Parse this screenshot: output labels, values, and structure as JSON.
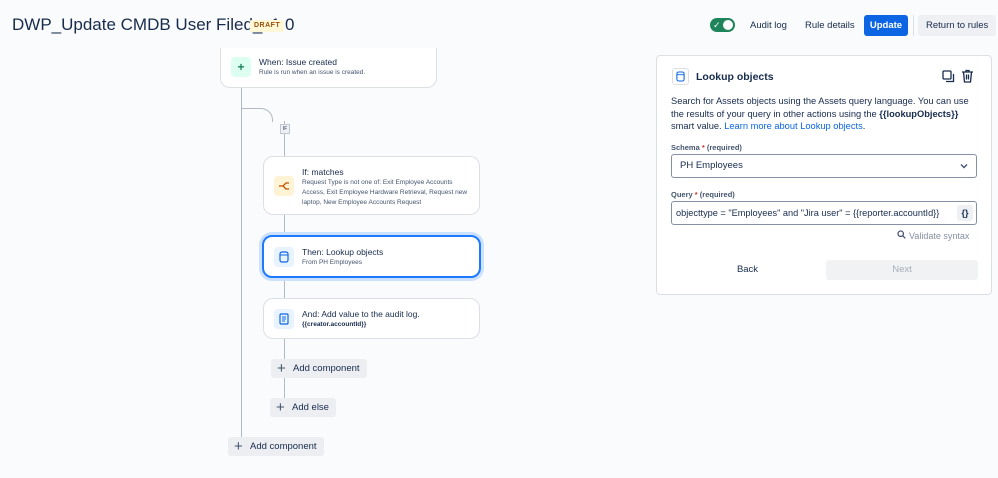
{
  "header": {
    "title": "DWP_Update CMDB User Filed_v1.0",
    "status": "DRAFT",
    "audit_log": "Audit log",
    "rule_details": "Rule details",
    "update": "Update",
    "return_to_rules": "Return to rules"
  },
  "flow": {
    "trigger": {
      "title": "When: Issue created",
      "subtitle": "Rule is run when an issue is created."
    },
    "if_badge": "IF",
    "condition": {
      "title": "If: matches",
      "subtitle": "Request Type is not one of: Exit Employee Accounts Access, Exit Employee Hardware Retrieval, Request new laptop, New Employee Accounts Request"
    },
    "action_lookup": {
      "title": "Then: Lookup objects",
      "subtitle": "From PH Employees"
    },
    "action_audit": {
      "title": "And: Add value to the audit log.",
      "subtitle": "{{creator.accountId}}"
    },
    "add_component_inner": "Add component",
    "add_else": "Add else",
    "add_component_outer": "Add component"
  },
  "panel": {
    "title": "Lookup objects",
    "desc_part1": "Search for Assets objects using the Assets query language. You can use the results of your query in other actions using the ",
    "desc_bold": "{{lookupObjects}}",
    "desc_part2": " smart value. ",
    "desc_link": "Learn more about Lookup objects",
    "desc_end": ".",
    "schema_label": "Schema",
    "required_star": "*",
    "required_text": "(required)",
    "schema_value": "PH Employees",
    "query_label": "Query",
    "query_value": "objecttype = \"Employees\" and \"Jira user\" = {{reporter.accountId}}",
    "query_button": "{}",
    "validate": "Validate syntax",
    "back": "Back",
    "next": "Next"
  },
  "colors": {
    "primary": "#0c66e4",
    "toggle_on": "#1f845a",
    "draft_bg": "#fff7d6",
    "selected_border": "#1d7afc"
  },
  "icons": {
    "trigger": "plus-icon",
    "condition": "branch-icon",
    "lookup": "database-icon",
    "audit": "document-icon",
    "duplicate": "duplicate-icon",
    "delete": "trash-icon",
    "search": "search-icon"
  }
}
